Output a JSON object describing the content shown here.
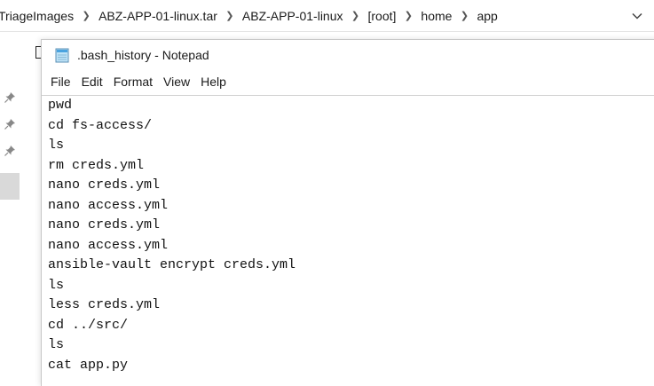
{
  "explorer": {
    "breadcrumb": [
      "TriageImages",
      "ABZ-APP-01-linux.tar",
      "ABZ-APP-01-linux",
      "[root]",
      "home",
      "app"
    ],
    "icons": {
      "separator": "chevron-right-icon",
      "dropdown": "chevron-down-icon",
      "pin": "pin-icon"
    }
  },
  "notepad": {
    "title": ".bash_history - Notepad",
    "icon": "notepad-icon",
    "menu": [
      "File",
      "Edit",
      "Format",
      "View",
      "Help"
    ],
    "lines": [
      "pwd",
      "cd fs-access/",
      "ls",
      "rm creds.yml",
      "nano creds.yml",
      "nano access.yml",
      "nano creds.yml",
      "nano access.yml",
      "ansible-vault encrypt creds.yml",
      "ls",
      "less creds.yml",
      "cd ../src/",
      "ls",
      "cat app.py"
    ]
  }
}
